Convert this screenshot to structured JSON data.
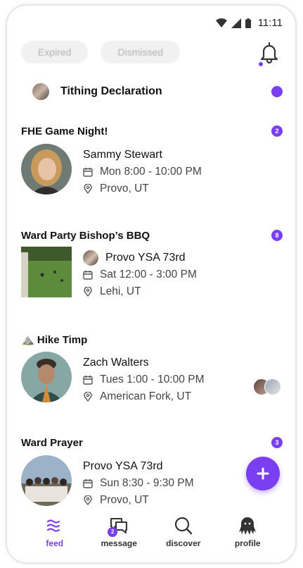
{
  "status_bar": {
    "time": "11:11"
  },
  "filters": {
    "expired": "Expired",
    "dismissed": "Dismissed"
  },
  "tithing": {
    "title": "Tithing Declaration"
  },
  "cards": [
    {
      "title": "FHE Game Night!",
      "badge": "2",
      "host": "Sammy Stewart",
      "time": "Mon 8:00 - 10:00 PM",
      "location": "Provo, UT"
    },
    {
      "title": "Ward Party Bishop’s BBQ",
      "badge": "8",
      "host": "Provo YSA 73rd",
      "time": "Sat 12:00 - 3:00 PM",
      "location": "Lehi, UT"
    },
    {
      "title": "Hike Timp",
      "badge": "",
      "emoji": "⛰️",
      "host": "Zach Walters",
      "time": "Tues 1:00 - 10:00 PM",
      "location": "American Fork, UT"
    },
    {
      "title": "Ward Prayer",
      "badge": "3",
      "host": "Provo YSA 73rd",
      "time": "Sun 8:30 - 9:30 PM",
      "location": "Provo, UT"
    }
  ],
  "bottom_nav": {
    "feed": "feed",
    "message": "message",
    "message_badge": "2",
    "discover": "discover",
    "profile": "profile"
  },
  "colors": {
    "accent": "#7b3ff2"
  }
}
